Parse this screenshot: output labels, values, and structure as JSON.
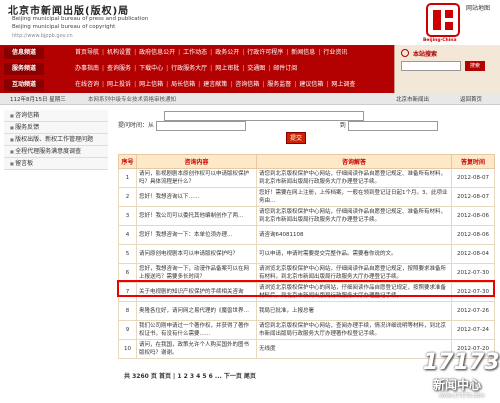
{
  "header": {
    "site_name": "北京市新闻出版(版权)局",
    "site_en1": "Beijing municipal bureau of press and publication",
    "site_en2": "Beijing municipal bureau of copyright",
    "site_url": "http://www.bjppb.gov.cn",
    "right_link": "网站地图",
    "logo_text": "Beijing·China"
  },
  "nav": {
    "rows": [
      {
        "category": "信息频道",
        "items": [
          "首页导航",
          "机构设置",
          "政府信息公开",
          "工作动态",
          "政务公开",
          "行政许可程序",
          "新闻信息",
          "行业资讯"
        ]
      },
      {
        "category": "服务频道",
        "items": [
          "办事指南",
          "查询服务",
          "下载中心",
          "行政服务大厅",
          "网上审批",
          "交通图",
          "邮件订阅"
        ]
      },
      {
        "category": "互动频道",
        "items": [
          "在线咨询",
          "网上投诉",
          "网上信箱",
          "局长信箱",
          "建言献策",
          "咨询信箱",
          "服务监督",
          "建议信箱",
          "网上调查"
        ]
      }
    ],
    "search": {
      "label": "本站搜索",
      "button": "搜索"
    }
  },
  "datebar": {
    "date": "112年8月15日 星期三",
    "marquee": "本网系列中级专业技术资格审核通知",
    "location": "北京市新闻出",
    "back": "返回首页"
  },
  "sidebar": {
    "items": [
      "咨询信箱",
      "服务反馈",
      "版权出版、新权工作管理问题",
      "全程代理服务满意度调查",
      "留言板"
    ]
  },
  "form": {
    "date_label": "提问时间：从",
    "to_label": "到",
    "submit_label": "提交"
  },
  "table": {
    "headers": [
      "序号",
      "咨询内容",
      "咨询解答",
      "答复时间"
    ],
    "rows": [
      {
        "no": "1",
        "q": "请问，影视剧剧本原创作权可以申请版权保护吗？具体流程是什么？",
        "a": "请您到北京版权保护中心网站，仔细阅读作品自愿登记规定、准备所有材料，到北京市新闻出版局行政服务大厅办理登记手续。",
        "date": "2012-08-07"
      },
      {
        "no": "2",
        "q": "您好！我想咨询以下……",
        "a": "您好！需要在网上注册，上传档案，一般在领到登记证日起1个月。3、此项业务由…",
        "date": "2012-08-07"
      },
      {
        "no": "3",
        "q": "您好！我公司可以委托其他编制创作了两…",
        "a": "请您到北京版权保护中心网站，仔细阅读作品自愿登记规定、准备所有材料，到北京市新闻出版局行政服务大厅办理登记手续。",
        "date": "2012-08-06"
      },
      {
        "no": "4",
        "q": "您好！我想咨询一下：本单位须办理…",
        "a": "请咨询64081108",
        "date": "2012-08-06"
      },
      {
        "no": "5",
        "q": "请问原创电视剧本可以申请版权保护吗？",
        "a": "可以申请，申请时需要提交完整作品。需要看你说的文。",
        "date": "2012-08-04"
      },
      {
        "no": "6",
        "q": "您好，我想咨询一下，动漫作品备案可以在网上报送吗？需要多长时间？",
        "a": "请浏览北京版权保护中心网站，仔细阅读作品自愿登记规定，按照要求准备所有材料，到北京市新闻出版局行政服务大厅办理登记手续。",
        "date": "2012-07-30"
      },
      {
        "no": "7",
        "q": "关于电视剧的知识产权保护的手续相关咨询",
        "a": "请浏览北京版权保护中心的网站，仔细阅读作品自愿登记规定，按照要求准备材料后，到北京市新闻出版局行政服务大厅办理登记手续。",
        "date": "2012-07-30"
      },
      {
        "no": "8",
        "q": "奥隆各位好，请问网之易代理的《魔兽世界…",
        "a": "我局已批准，上报总署",
        "date": "2012-07-26"
      },
      {
        "no": "9",
        "q": "我们公司刚申请过一个著作权，并获得了著作权证书，有没有什么需要……",
        "a": "请您到北京版权保护中心网站，查阅办理手续，情况详细说明等材料，到北京市新闻出版局行政服务大厅办理著作权登记手续。",
        "date": "2012-07-24"
      },
      {
        "no": "10",
        "q": "请问，在我国，政策允许个人购买国外的图书版权吗？谢谢。",
        "a": "无线度",
        "date": "2012-07-20"
      }
    ]
  },
  "pager": {
    "text": "共 3260 页 首页 | 1 2 3 4 5 6 ... 下一页 尾页"
  },
  "watermark": {
    "num": "17173",
    "cn": "新闻中心",
    "url": "www.17173.com"
  },
  "colors": {
    "nav_red": "#b30000",
    "header_accent": "#c00",
    "highlight_border": "#e00"
  }
}
